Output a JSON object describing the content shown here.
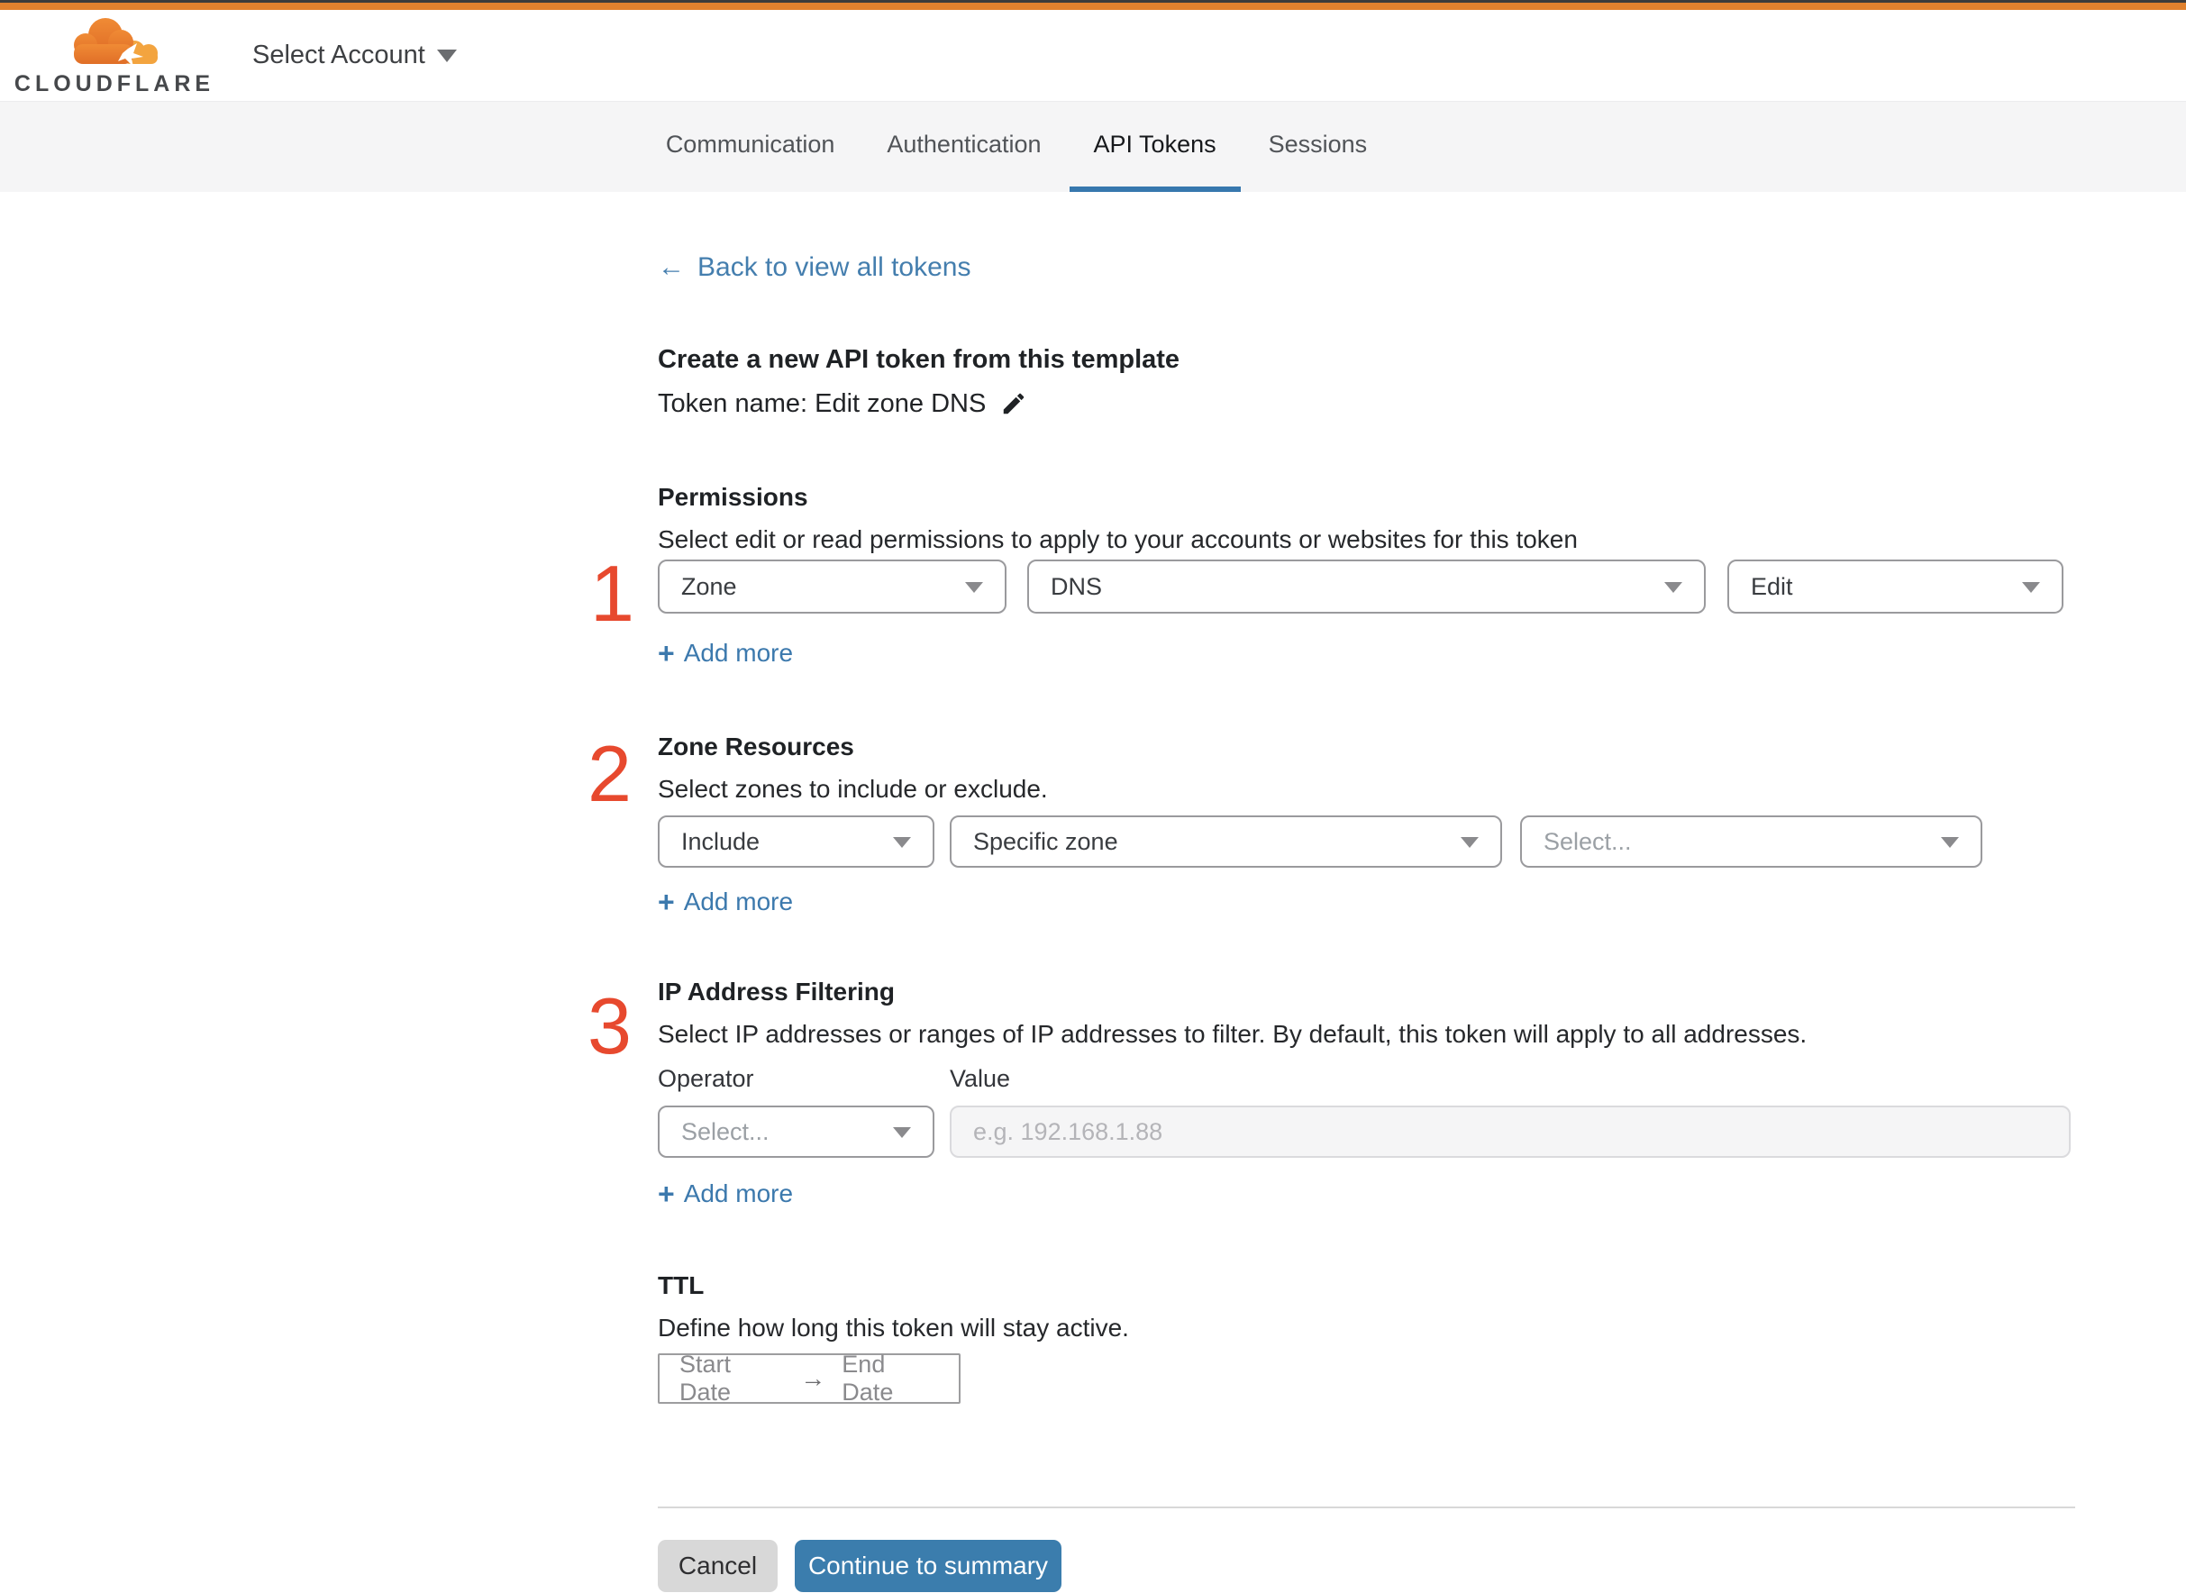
{
  "colors": {
    "brand_orange": "#e0812e",
    "accent_blue": "#3b7dad",
    "tab_underline_blue": "#3778ae",
    "marker_red": "#e7492e"
  },
  "header": {
    "brand": "CLOUDFLARE",
    "account_selector": "Select Account"
  },
  "tabs": [
    {
      "label": "Communication",
      "active": false
    },
    {
      "label": "Authentication",
      "active": false
    },
    {
      "label": "API Tokens",
      "active": true
    },
    {
      "label": "Sessions",
      "active": false
    }
  ],
  "ui": {
    "plus": "+",
    "back_arrow": "←",
    "range_arrow": "→"
  },
  "content": {
    "back_link": "Back to view all tokens",
    "step_markers": {
      "one": "1",
      "two": "2",
      "three": "3"
    },
    "template_section": {
      "title": "Create a new API token from this template",
      "token_name": "Token name: Edit zone DNS"
    },
    "permissions": {
      "heading": "Permissions",
      "description": "Select edit or read permissions to apply to your accounts or websites for this token",
      "selects": [
        {
          "value": "Zone"
        },
        {
          "value": "DNS"
        },
        {
          "value": "Edit"
        }
      ],
      "add_more": "Add more"
    },
    "zone_resources": {
      "heading": "Zone Resources",
      "description": "Select zones to include or exclude.",
      "selects": [
        {
          "value": "Include"
        },
        {
          "value": "Specific zone"
        },
        {
          "value": "Select..."
        }
      ],
      "add_more": "Add more"
    },
    "ip_filtering": {
      "heading": "IP Address Filtering",
      "description": "Select IP addresses or ranges of IP addresses to filter. By default, this token will apply to all addresses.",
      "operator_label": "Operator",
      "value_label": "Value",
      "operator_select": {
        "value": "Select..."
      },
      "value_placeholder": "e.g. 192.168.1.88",
      "add_more": "Add more"
    },
    "ttl": {
      "heading": "TTL",
      "description": "Define how long this token will stay active.",
      "start_date": "Start Date",
      "end_date": "End Date"
    },
    "footer": {
      "cancel": "Cancel",
      "continue": "Continue to summary"
    }
  }
}
